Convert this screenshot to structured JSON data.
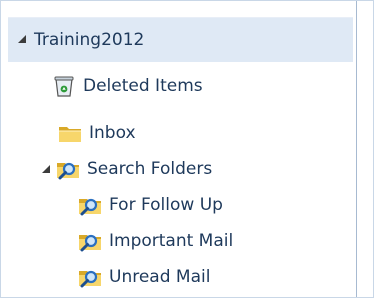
{
  "folder_pane": {
    "account": {
      "label": "Training2012"
    },
    "items": [
      {
        "label": "Deleted Items",
        "icon": "recycle-bin-icon"
      },
      {
        "label": "Inbox",
        "icon": "folder-icon"
      },
      {
        "label": "Search Folders",
        "icon": "search-folder-icon",
        "expanded": true
      },
      {
        "label": "For Follow Up",
        "icon": "search-folder-icon"
      },
      {
        "label": "Important Mail",
        "icon": "search-folder-icon"
      },
      {
        "label": "Unread Mail",
        "icon": "search-folder-icon"
      }
    ]
  }
}
